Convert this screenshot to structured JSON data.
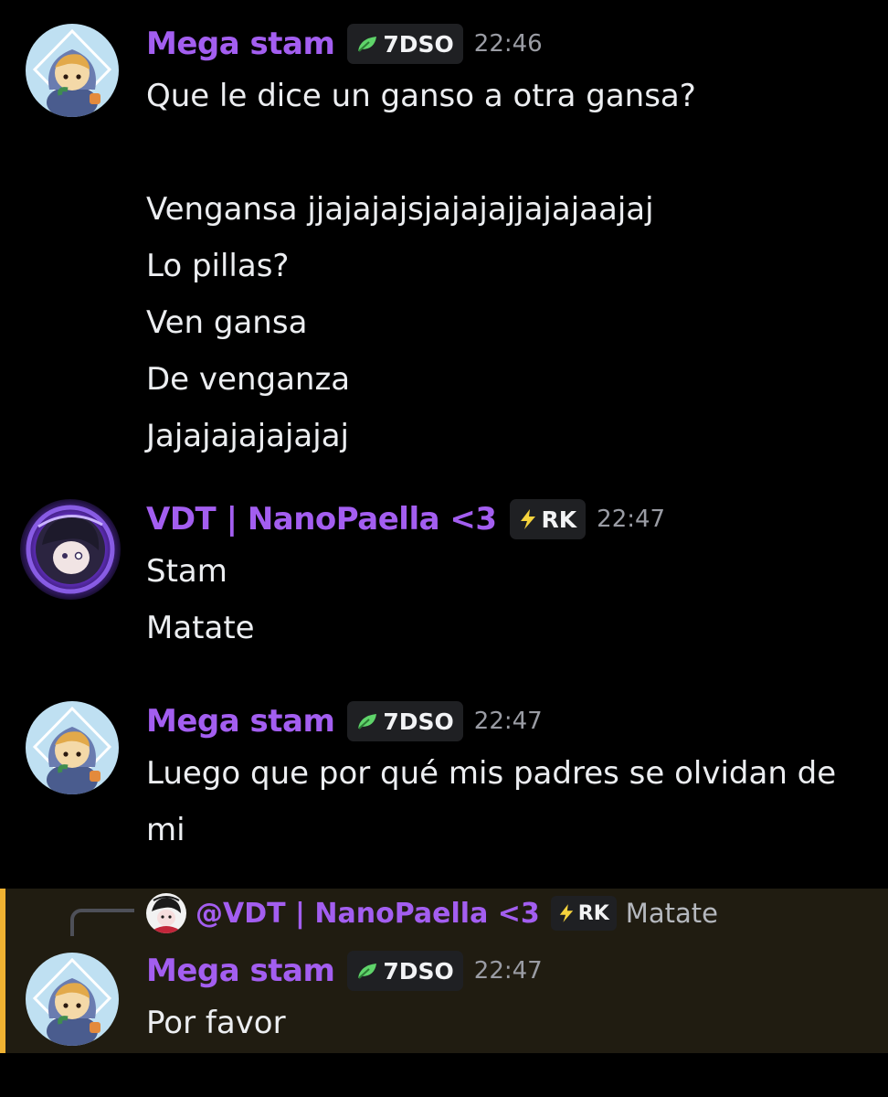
{
  "colors": {
    "background": "#000000",
    "username": "#a35ef0",
    "timestamp": "#9a9ca4",
    "text": "#eceef1",
    "tag_bg": "#1f2023",
    "mention_bg": "#201c11",
    "mention_bar": "#f0b232"
  },
  "messages": [
    {
      "author": "Mega stam",
      "tag_icon": "leaf-icon",
      "tag": "7DSO",
      "time": "22:46",
      "lines": [
        "Que le dice un ganso a otra gansa?",
        "",
        "Vengansa jjajajajsjajajajjajajaajaj",
        "Lo pillas?",
        "Ven gansa",
        "De venganza",
        "Jajajajajajajaj"
      ]
    },
    {
      "author": "VDT | NanoPaella <3",
      "tag_icon": "lightning-icon",
      "tag": "RK",
      "time": "22:47",
      "lines": [
        "Stam",
        "Matate"
      ]
    },
    {
      "author": "Mega stam",
      "tag_icon": "leaf-icon",
      "tag": "7DSO",
      "time": "22:47",
      "lines": [
        "Luego que por qué mis padres se olvidan de mi"
      ]
    },
    {
      "reply": {
        "author": "@VDT | NanoPaella <3",
        "tag_icon": "lightning-icon",
        "tag": "RK",
        "text": "Matate"
      },
      "author": "Mega stam",
      "tag_icon": "leaf-icon",
      "tag": "7DSO",
      "time": "22:47",
      "lines": [
        "Por favor"
      ]
    }
  ]
}
